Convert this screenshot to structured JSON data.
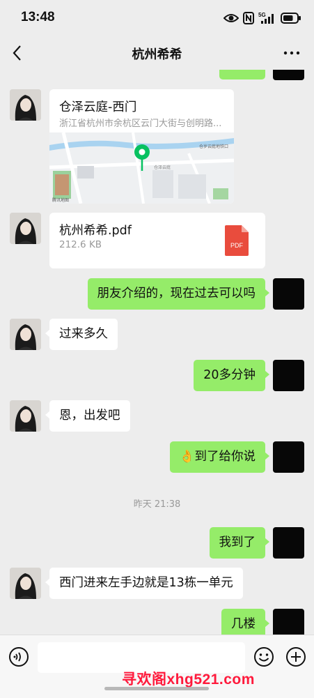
{
  "status_bar": {
    "time": "13:48",
    "network": "5G",
    "signal_bars": 4,
    "battery_level": 0.75
  },
  "header": {
    "title": "杭州希希"
  },
  "messages": {
    "location": {
      "name": "仓泽云庭-西门",
      "address": "浙江省杭州市余杭区云门大街与创明路...",
      "map_poi_1": "仓泽云庭",
      "map_poi_2": "仓岁云庭地铁口",
      "map_provider": "腾讯地图"
    },
    "file": {
      "name": "杭州希希.pdf",
      "size": "212.6 KB",
      "type_label": "PDF"
    },
    "m1": "朋友介绍的，现在过去可以吗",
    "m2": "过来多久",
    "m3": "20多分钟",
    "m4": "恩，出发吧",
    "m5_emoji": "👌",
    "m5": "到了给你说",
    "timestamp": "昨天 21:38",
    "m6": "我到了",
    "m7": "西门进来左手边就是13栋一单元",
    "m8": "几楼"
  },
  "watermark": "寻欢阁xhg521.com",
  "colors": {
    "sent_bubble": "#95ec69",
    "received_bubble": "#ffffff",
    "background": "#ededed",
    "map_pin": "#07c160",
    "pdf_icon": "#e94c3d"
  }
}
